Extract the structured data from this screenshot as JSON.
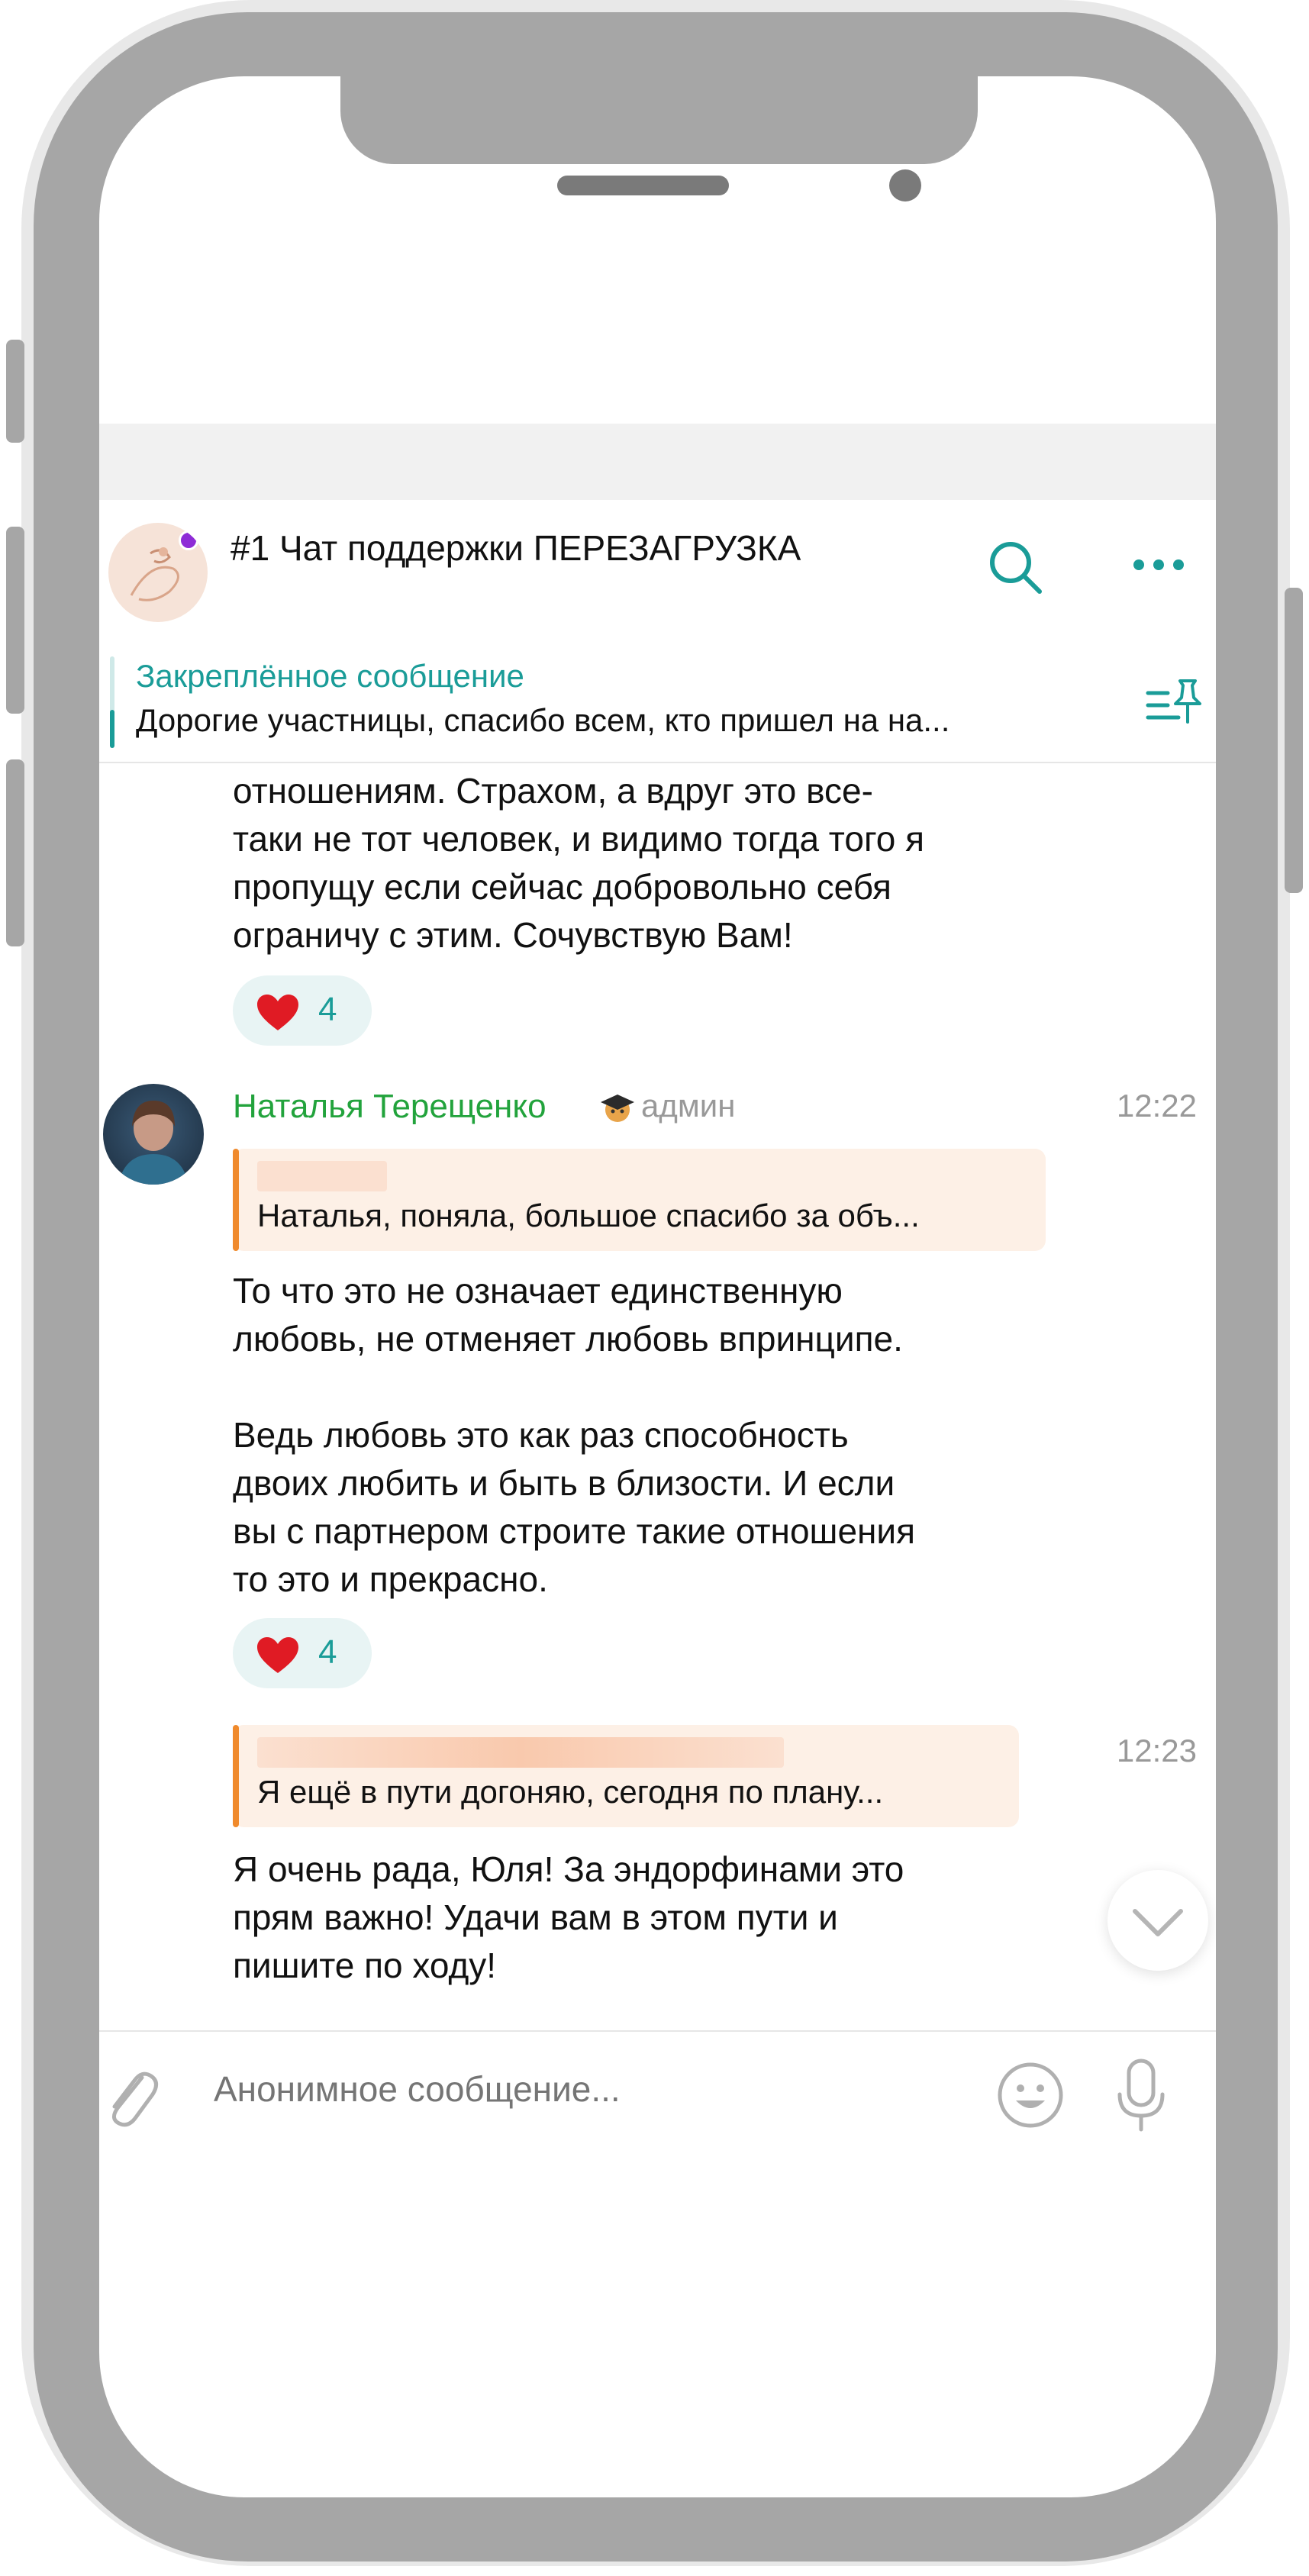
{
  "chat": {
    "title": "#1 Чат поддержки ПЕРЕЗАГРУЗКА"
  },
  "pinned": {
    "label": "Закреплённое сообщение",
    "text": "Дорогие участницы, спасибо всем, кто пришел на на..."
  },
  "messages": [
    {
      "text": "отношениям. Страхом, а вдруг это все-\nтаки не тот человек, и видимо тогда того я\nпропущу если сейчас добровольно себя\nограничу с этим. Сочувствую Вам!",
      "reaction": {
        "emoji": "heart",
        "count": "4"
      }
    },
    {
      "author": "Наталья Терещенко",
      "role": "админ",
      "time": "12:22",
      "reply_text": "Наталья, поняла, большое спасибо за объ...",
      "text": "То что это не означает единственную\nлюбовь, не отменяет любовь впринципе.\n\nВедь любовь это как раз способность\nдвоих любить и быть в близости. И если\nвы с партнером строите такие отношения\nто это и прекрасно.",
      "reaction": {
        "emoji": "heart",
        "count": "4"
      }
    },
    {
      "time": "12:23",
      "reply_text": "Я ещё в пути догоняю, сегодня по плану...",
      "text": "Я очень рада, Юля! За эндорфинами это\nпрям важно! Удачи вам в этом пути и\nпишите по ходу!"
    }
  ],
  "composer": {
    "placeholder": "Анонимное сообщение..."
  },
  "colors": {
    "accent": "#1a9c98",
    "author_name": "#22a33c",
    "reply_bar": "#f08a2c",
    "reply_bg": "#fdf0e6",
    "reaction_bg": "#e8f4f4",
    "frame": "#a6a6a6"
  },
  "icons": {
    "header": [
      "search-icon",
      "more-icon"
    ],
    "pinned": "pin-list-icon",
    "composer": [
      "paperclip-icon",
      "emoji-icon",
      "microphone-icon"
    ],
    "scroll": "chevron-down-icon"
  }
}
